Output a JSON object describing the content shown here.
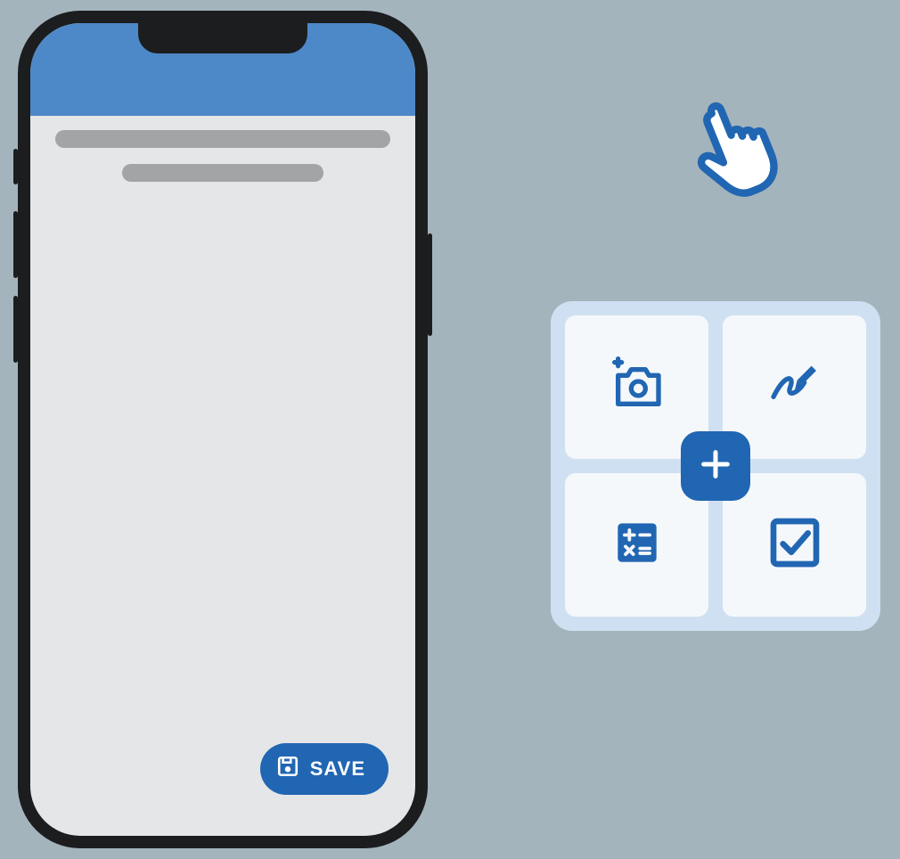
{
  "colors": {
    "canvas": "#a4b4bd",
    "header": "#4d89c8",
    "accent": "#2166b2",
    "screen": "#e5e6e7",
    "panel": "#cfe0f2",
    "tile": "#f5f8fb"
  },
  "phone": {
    "save_label": "SAVE",
    "save_icon": "save-icon"
  },
  "cursor_icon": "hand-pointer-icon",
  "action_grid": {
    "center_icon": "plus-icon",
    "tiles": [
      {
        "icon": "add-photo-icon"
      },
      {
        "icon": "signature-icon"
      },
      {
        "icon": "calculator-icon"
      },
      {
        "icon": "checkbox-icon"
      }
    ]
  }
}
